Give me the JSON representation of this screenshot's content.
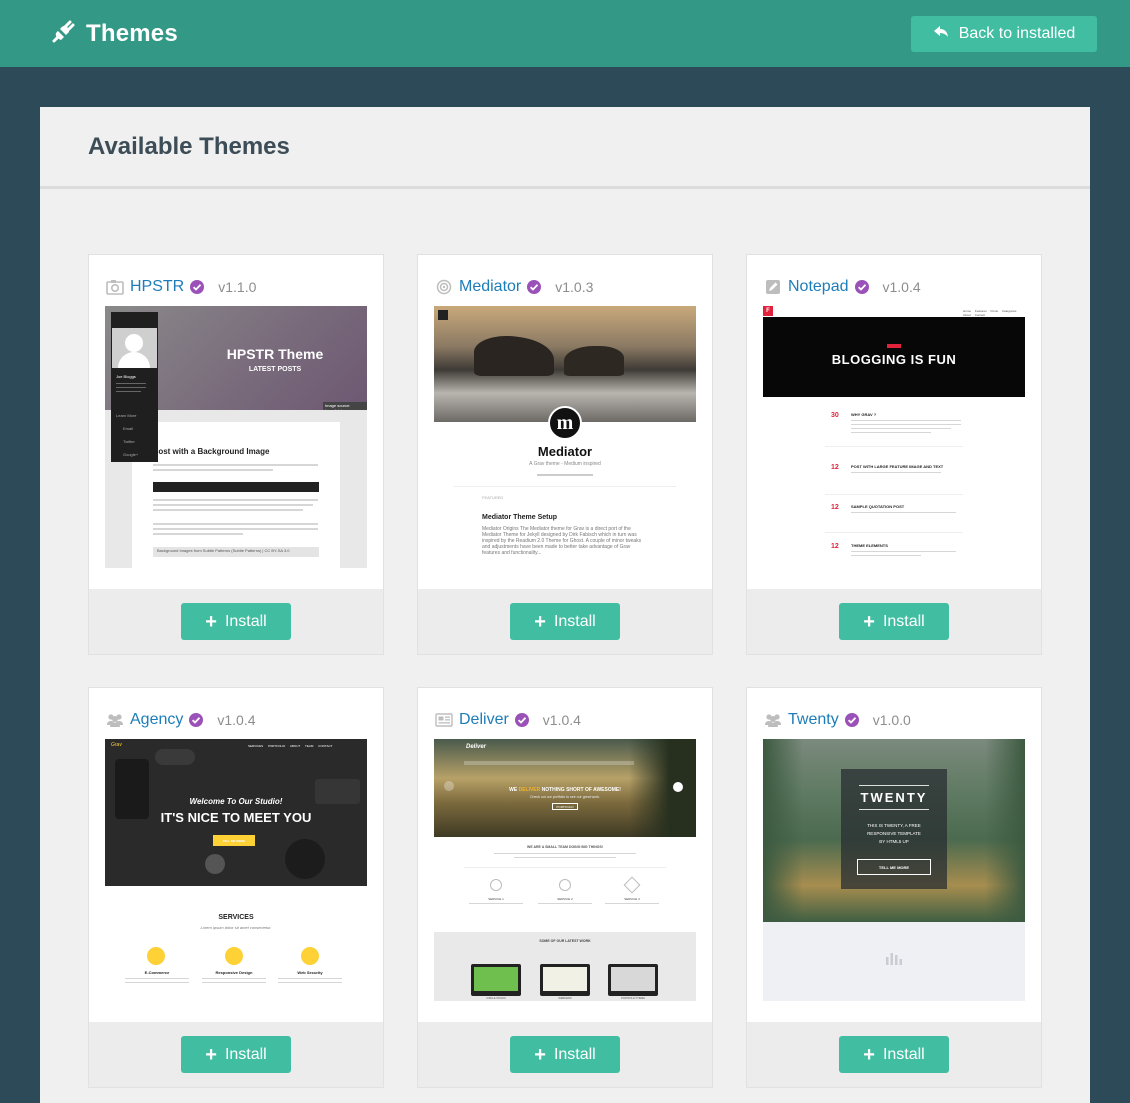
{
  "header": {
    "title": "Themes",
    "back_label": "Back to installed"
  },
  "panel": {
    "heading": "Available Themes"
  },
  "install_label": "Install",
  "colors": {
    "header_bg": "#349886",
    "accent": "#41bea2",
    "page_bg": "#2c4a57",
    "link": "#1d7db8",
    "verified": "#9a52b8"
  },
  "themes": [
    {
      "name": "HPSTR",
      "version": "v1.1.0",
      "icon": "camera-icon"
    },
    {
      "name": "Mediator",
      "version": "v1.0.3",
      "icon": "target-icon"
    },
    {
      "name": "Notepad",
      "version": "v1.0.4",
      "icon": "pencil-icon"
    },
    {
      "name": "Agency",
      "version": "v1.0.4",
      "icon": "users-icon"
    },
    {
      "name": "Deliver",
      "version": "v1.0.4",
      "icon": "newspaper-icon"
    },
    {
      "name": "Twenty",
      "version": "v1.0.0",
      "icon": "users-icon"
    }
  ],
  "previews": {
    "hpstr": {
      "heading": "HPSTR Theme",
      "sub": "LATEST POSTS",
      "post_title": "Post with a Background Image",
      "user": "Joe Bloggs",
      "menu": [
        "Learn More",
        "Email",
        "Twitter",
        "Google+"
      ],
      "caption": "Image source: tangelglet",
      "footer": "Background Images from Subtle Patterns (Subtle Patterns) | CC BY-SA 3.0"
    },
    "mediator": {
      "logo": "m",
      "name": "Mediator",
      "tagline": "A Grav theme - Medium inspired",
      "label": "FEATURED",
      "post_title": "Mediator Theme Setup",
      "excerpt": "Mediator Origins The Mediator theme for Grav is a direct port of the Mediator Theme for Jekyll designed by Dirk Fabisch which in turn was inspired by the Readium 2.0 Theme for Ghost. A couple of minor tweaks and adjustments have been made to better take advantage of Grav features and functionality..."
    },
    "notepad": {
      "logo": "F",
      "hero": "BLOGGING IS FUN",
      "nav": [
        "Home",
        "Features Posts",
        "Categories",
        "About",
        "Contact"
      ],
      "posts": [
        {
          "day": "30",
          "title": "WHY GRAV ?"
        },
        {
          "day": "12",
          "title": "POST WITH LARGE FEATURE IMAGE AND TEXT"
        },
        {
          "day": "12",
          "title": "SAMPLE QUOTATION POST"
        },
        {
          "day": "12",
          "title": "THEME ELEMENTS"
        }
      ]
    },
    "agency": {
      "brand": "Grav",
      "nav": [
        "SERVICES",
        "PORTFOLIO",
        "ABOUT",
        "TEAM",
        "CONTACT"
      ],
      "welcome": "Welcome To Our Studio!",
      "hero": "IT'S NICE TO MEET YOU",
      "cta": "TELL ME MORE",
      "services_title": "SERVICES",
      "services_sub": "Lorem ipsum dolor sit amet consectetur.",
      "services": [
        "E-Commerce",
        "Responsive Design",
        "Web Security"
      ]
    },
    "deliver": {
      "brand": "Deliver",
      "hero_a": "WE",
      "hero_b": "DELIVER",
      "hero_c": "NOTHING SHORT OF AWESOME!",
      "hero_sub": "Check out our portfolio to see our great work.",
      "cta": "PORTFOLIO",
      "team": "WE ARE A SMALL TEAM DOING BIG THINGS!",
      "services": [
        "SERVICE 1",
        "SERVICE 2",
        "SERVICE 3"
      ],
      "work": "SOME OF OUR LATEST WORK",
      "works": [
        "CIRCLE STUDIO",
        "WEBDRAW",
        "PORTFOLIO THEME"
      ]
    },
    "twenty": {
      "title": "TWENTY",
      "line1": "THIS IS TWENTY, A FREE",
      "line2": "RESPONSIVE TEMPLATE",
      "line3": "BY HTML5 UP",
      "cta": "TELL ME MORE"
    }
  }
}
